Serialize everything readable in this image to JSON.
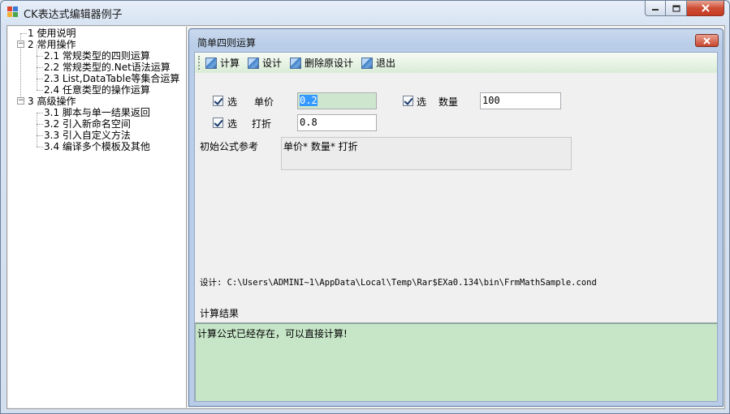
{
  "window": {
    "title": "CK表达式编辑器例子"
  },
  "tree": {
    "items": [
      {
        "label": "1 使用说明",
        "level": 0
      },
      {
        "label": "2 常用操作",
        "level": 0,
        "expanded": true
      },
      {
        "label": "2.1 常规类型的四则运算",
        "level": 1
      },
      {
        "label": "2.2 常规类型的.Net语法运算",
        "level": 1
      },
      {
        "label": "2.3 List,DataTable等集合运算",
        "level": 1
      },
      {
        "label": "2.4 任意类型的操作运算",
        "level": 1
      },
      {
        "label": "3 高级操作",
        "level": 0,
        "expanded": true
      },
      {
        "label": "3.1 脚本与单一结果返回",
        "level": 1
      },
      {
        "label": "3.2 引入新命名空间",
        "level": 1
      },
      {
        "label": "3.3 引入自定义方法",
        "level": 1
      },
      {
        "label": "3.4 编译多个模板及其他",
        "level": 1
      }
    ]
  },
  "child": {
    "title": "简单四则运算",
    "toolbar": {
      "calc": "计算",
      "design": "设计",
      "delete": "删除原设计",
      "exit": "退出"
    },
    "fields": {
      "price": {
        "check": "选",
        "label": "单价",
        "value": "0.2"
      },
      "qty": {
        "check": "选",
        "label": "数量",
        "value": "100"
      },
      "discount": {
        "check": "选",
        "label": "打折",
        "value": "0.8"
      }
    },
    "formula": {
      "label": "初始公式参考",
      "value": "单价* 数量* 打折"
    },
    "design_path": "设计: C:\\Users\\ADMINI~1\\AppData\\Local\\Temp\\Rar$EXa0.134\\bin\\FrmMathSample.cond",
    "result": {
      "label": "计算结果",
      "value": "计算公式已经存在，可以直接计算!"
    }
  },
  "colors": {
    "result_bg": "#c7e6c8",
    "selection": "#3399ff",
    "close_red": "#c9462d"
  },
  "icons": {
    "toolbar": "picture-icon",
    "window_close": "close-icon"
  }
}
